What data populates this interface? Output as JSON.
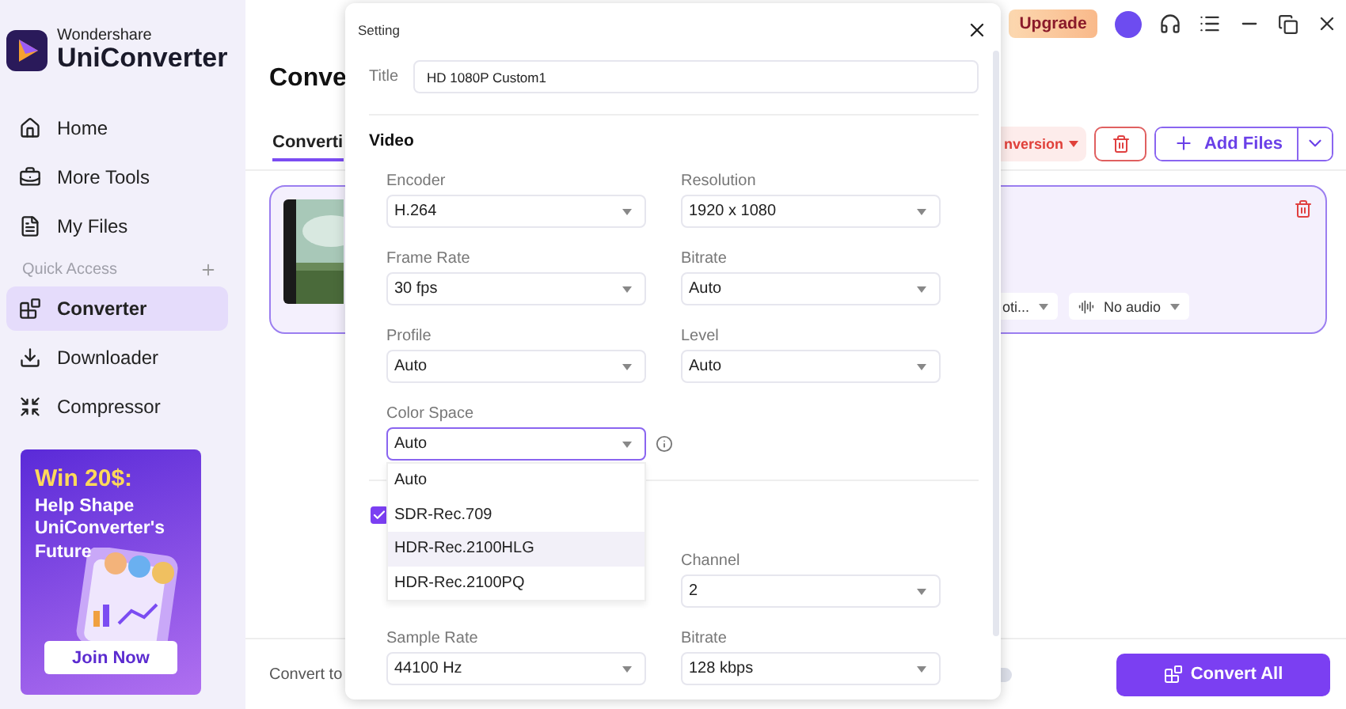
{
  "sidebar": {
    "brand_small": "Wondershare",
    "brand": "UniConverter",
    "items": [
      {
        "label": "Home",
        "selected": false
      },
      {
        "label": "More Tools",
        "selected": false
      },
      {
        "label": "My Files",
        "selected": false
      }
    ],
    "section": "Quick Access",
    "quick_items": [
      {
        "label": "Converter",
        "selected": true
      },
      {
        "label": "Downloader",
        "selected": false
      },
      {
        "label": "Compressor",
        "selected": false
      }
    ],
    "promo": {
      "headline": "Win 20$:",
      "text": "Help Shape UniConverter's Future",
      "button": "Join Now"
    }
  },
  "topbar": {
    "upgrade": "Upgrade"
  },
  "main": {
    "title": "Conve",
    "tabs": [
      {
        "label": "Converti",
        "selected": true
      }
    ],
    "status_button": "nversion",
    "add_files": "Add Files",
    "file": {
      "format_chip": "oti...",
      "audio_chip": "No audio"
    },
    "convert_to": "Convert to",
    "merge_toggle": {
      "on": false
    },
    "convert_all": "Convert All"
  },
  "dialog": {
    "title": "Setting",
    "name_label": "Title",
    "name_value": "HD 1080P Custom1",
    "video_heading": "Video",
    "video_fields": [
      {
        "label": "Encoder",
        "value": "H.264"
      },
      {
        "label": "Resolution",
        "value": "1920 x 1080"
      },
      {
        "label": "Frame Rate",
        "value": "30 fps"
      },
      {
        "label": "Bitrate",
        "value": "Auto"
      },
      {
        "label": "Profile",
        "value": "Auto"
      },
      {
        "label": "Level",
        "value": "Auto"
      }
    ],
    "color_space": {
      "label": "Color Space",
      "value": "Auto",
      "open": true,
      "options": [
        {
          "label": "Auto",
          "highlighted": false
        },
        {
          "label": "SDR-Rec.709",
          "highlighted": false
        },
        {
          "label": "HDR-Rec.2100HLG",
          "highlighted": true
        },
        {
          "label": "HDR-Rec.2100PQ",
          "highlighted": false
        }
      ]
    },
    "audio": {
      "checked": true,
      "rows": [
        [
          null,
          {
            "label": "Channel",
            "value": "2"
          }
        ],
        [
          {
            "label": "Sample Rate",
            "value": "44100 Hz"
          },
          {
            "label": "Bitrate",
            "value": "128 kbps"
          }
        ]
      ]
    }
  }
}
